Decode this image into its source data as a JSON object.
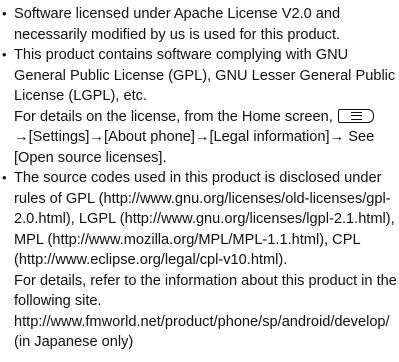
{
  "bullet_glyph": "•",
  "items": [
    {
      "text": "Software licensed under Apache License V2.0 and necessarily modified by us is used for this product."
    },
    {
      "intro": "This product contains software complying with GNU General Public License (GPL), GNU Lesser General Public License (LGPL), etc.",
      "detail_prefix": "For details on the license, from the Home screen,",
      "menu_key_icon": "menu-key-icon",
      "detail_path": "→[Settings]→[About phone]→[Legal information]→ See [Open source licenses]."
    },
    {
      "intro": "The source codes used in this product is disclosed under rules of GPL (http://www.gnu.org/licenses/old-licenses/gpl-2.0.html), LGPL (http://www.gnu.org/licenses/lgpl-2.1.html), MPL (http://www.mozilla.org/MPL/MPL-1.1.html), CPL (http://www.eclipse.org/legal/cpl-v10.html).",
      "detail": "For details, refer to the information about this product in the following site.",
      "url": "http://www.fmworld.net/product/phone/sp/android/develop/ (in Japanese only)"
    }
  ]
}
